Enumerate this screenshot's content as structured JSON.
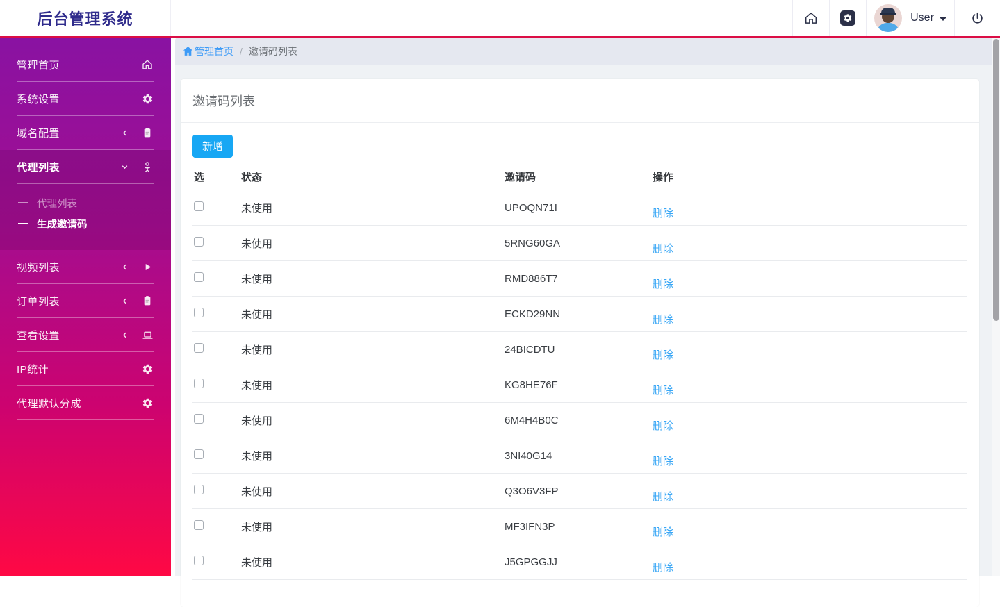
{
  "header": {
    "app_title": "后台管理系统",
    "user_label": "User"
  },
  "sidebar": {
    "submenu_bullet": "—",
    "items": [
      {
        "label": "管理首页",
        "icon": "home-icon"
      },
      {
        "label": "系统设置",
        "icon": "gear-icon"
      },
      {
        "label": "域名配置",
        "icon": "clipboard-icon",
        "chevron": "left"
      },
      {
        "label": "代理列表",
        "icon": "person-icon",
        "chevron": "down",
        "expanded": true,
        "children": [
          {
            "label": "代理列表",
            "active": false
          },
          {
            "label": "生成邀请码",
            "active": true
          }
        ]
      },
      {
        "label": "视频列表",
        "icon": "play-icon",
        "chevron": "left"
      },
      {
        "label": "订单列表",
        "icon": "clipboard-icon",
        "chevron": "left"
      },
      {
        "label": "查看设置",
        "icon": "laptop-icon",
        "chevron": "left"
      },
      {
        "label": "IP统计",
        "icon": "gear-icon"
      },
      {
        "label": "代理默认分成",
        "icon": "gear-icon"
      }
    ]
  },
  "breadcrumb": {
    "home_label": "管理首页",
    "separator": "/",
    "current": "邀请码列表"
  },
  "page": {
    "card_title": "邀请码列表",
    "add_button_label": "新增",
    "table": {
      "headers": [
        "选",
        "状态",
        "邀请码",
        "操作"
      ],
      "delete_label": "删除",
      "rows": [
        {
          "selected": false,
          "status": "未使用",
          "code": "UPOQN71I"
        },
        {
          "selected": false,
          "status": "未使用",
          "code": "5RNG60GA"
        },
        {
          "selected": false,
          "status": "未使用",
          "code": "RMD886T7"
        },
        {
          "selected": false,
          "status": "未使用",
          "code": "ECKD29NN"
        },
        {
          "selected": false,
          "status": "未使用",
          "code": "24BICDTU"
        },
        {
          "selected": false,
          "status": "未使用",
          "code": "KG8HE76F"
        },
        {
          "selected": false,
          "status": "未使用",
          "code": "6M4H4B0C"
        },
        {
          "selected": false,
          "status": "未使用",
          "code": "3NI40G14"
        },
        {
          "selected": false,
          "status": "未使用",
          "code": "Q3O6V3FP"
        },
        {
          "selected": false,
          "status": "未使用",
          "code": "MF3IFN3P"
        },
        {
          "selected": false,
          "status": "未使用",
          "code": "J5GPGGJJ"
        }
      ]
    }
  },
  "colors": {
    "header_accent_line": "#DB0E45",
    "logo_text": "#302C8C",
    "sidebar_gradient_top": "#8912A2",
    "sidebar_gradient_bottom": "#FF0844",
    "primary_button": "#17A7F4",
    "link_blue": "#3AA7F5",
    "breadcrumb_link": "#3D9BF7"
  }
}
